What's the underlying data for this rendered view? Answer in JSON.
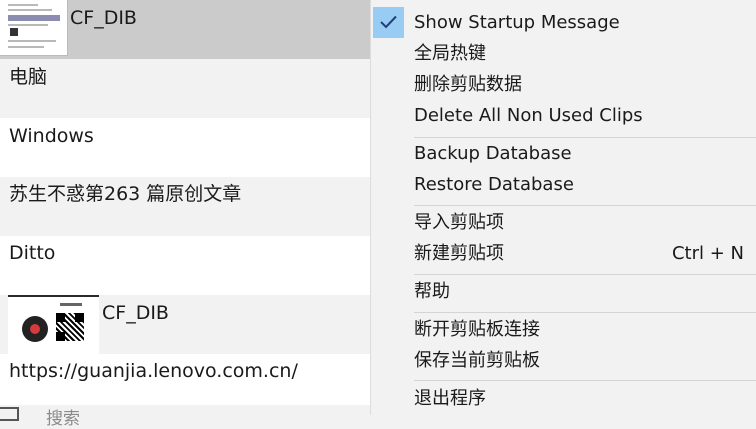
{
  "clips": [
    {
      "text": "CF_DIB"
    },
    {
      "text": "电脑"
    },
    {
      "text": "Windows"
    },
    {
      "text": "苏生不惑第263 篇原创文章"
    },
    {
      "text": "Ditto"
    },
    {
      "text": "CF_DIB"
    },
    {
      "text": "https://guanjia.lenovo.com.cn/"
    }
  ],
  "search": {
    "label": "搜索"
  },
  "menu": {
    "show_startup_message": "Show Startup Message",
    "global_hotkeys": "全局热键",
    "delete_clip_data": "删除剪贴数据",
    "delete_all_non_used_clips": "Delete All Non Used Clips",
    "backup_database": "Backup Database",
    "restore_database": "Restore Database",
    "import_clip": "导入剪贴项",
    "new_clip": "新建剪贴项",
    "new_clip_shortcut": "Ctrl + N",
    "help": "帮助",
    "disconnect_clipboard": "断开剪贴板连接",
    "save_current_clipboard": "保存当前剪贴板",
    "exit_program": "退出程序"
  },
  "icons": {
    "check": "checkmark-icon",
    "search": "search-box-icon"
  },
  "colors": {
    "check_highlight": "#99ccf2",
    "selected_row": "#cbcbcb",
    "menu_bg": "#f2f2f2"
  }
}
